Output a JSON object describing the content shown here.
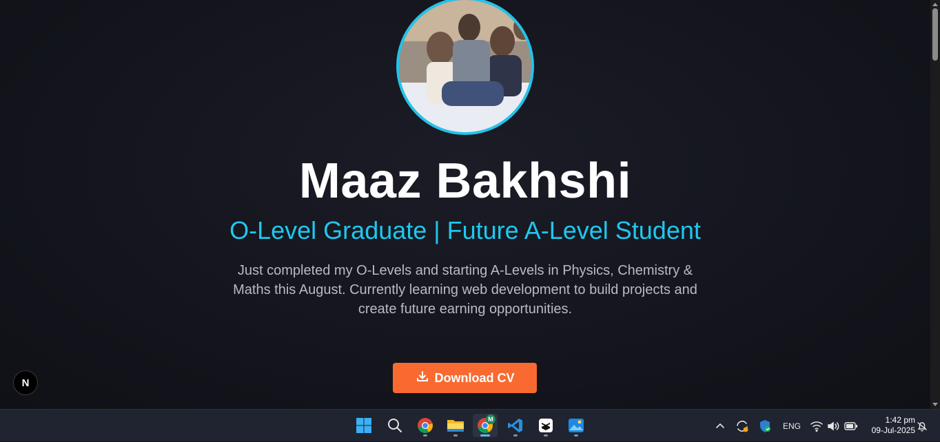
{
  "profile": {
    "name": "Maaz Bakhshi",
    "subtitle": "O-Level Graduate | Future A-Level Student",
    "description": "Just completed my O-Levels and starting A-Levels in Physics, Chemistry & Maths this August. Currently learning web development to build projects and create future earning opportunities.",
    "cta_label": "Download CV"
  },
  "next_badge": "N",
  "taskbar": {
    "apps": [
      "windows-start",
      "search",
      "chrome",
      "file-explorer",
      "chrome-profile-m",
      "vscode",
      "capcut",
      "photos"
    ],
    "chrome_profile_badge": "M",
    "tray_lang": "ENG",
    "time": "1:42 pm",
    "date": "09-Jul-2025"
  },
  "colors": {
    "accent_cyan": "#1ec8ef",
    "button_orange": "#f86a30",
    "background": "#14151d"
  }
}
